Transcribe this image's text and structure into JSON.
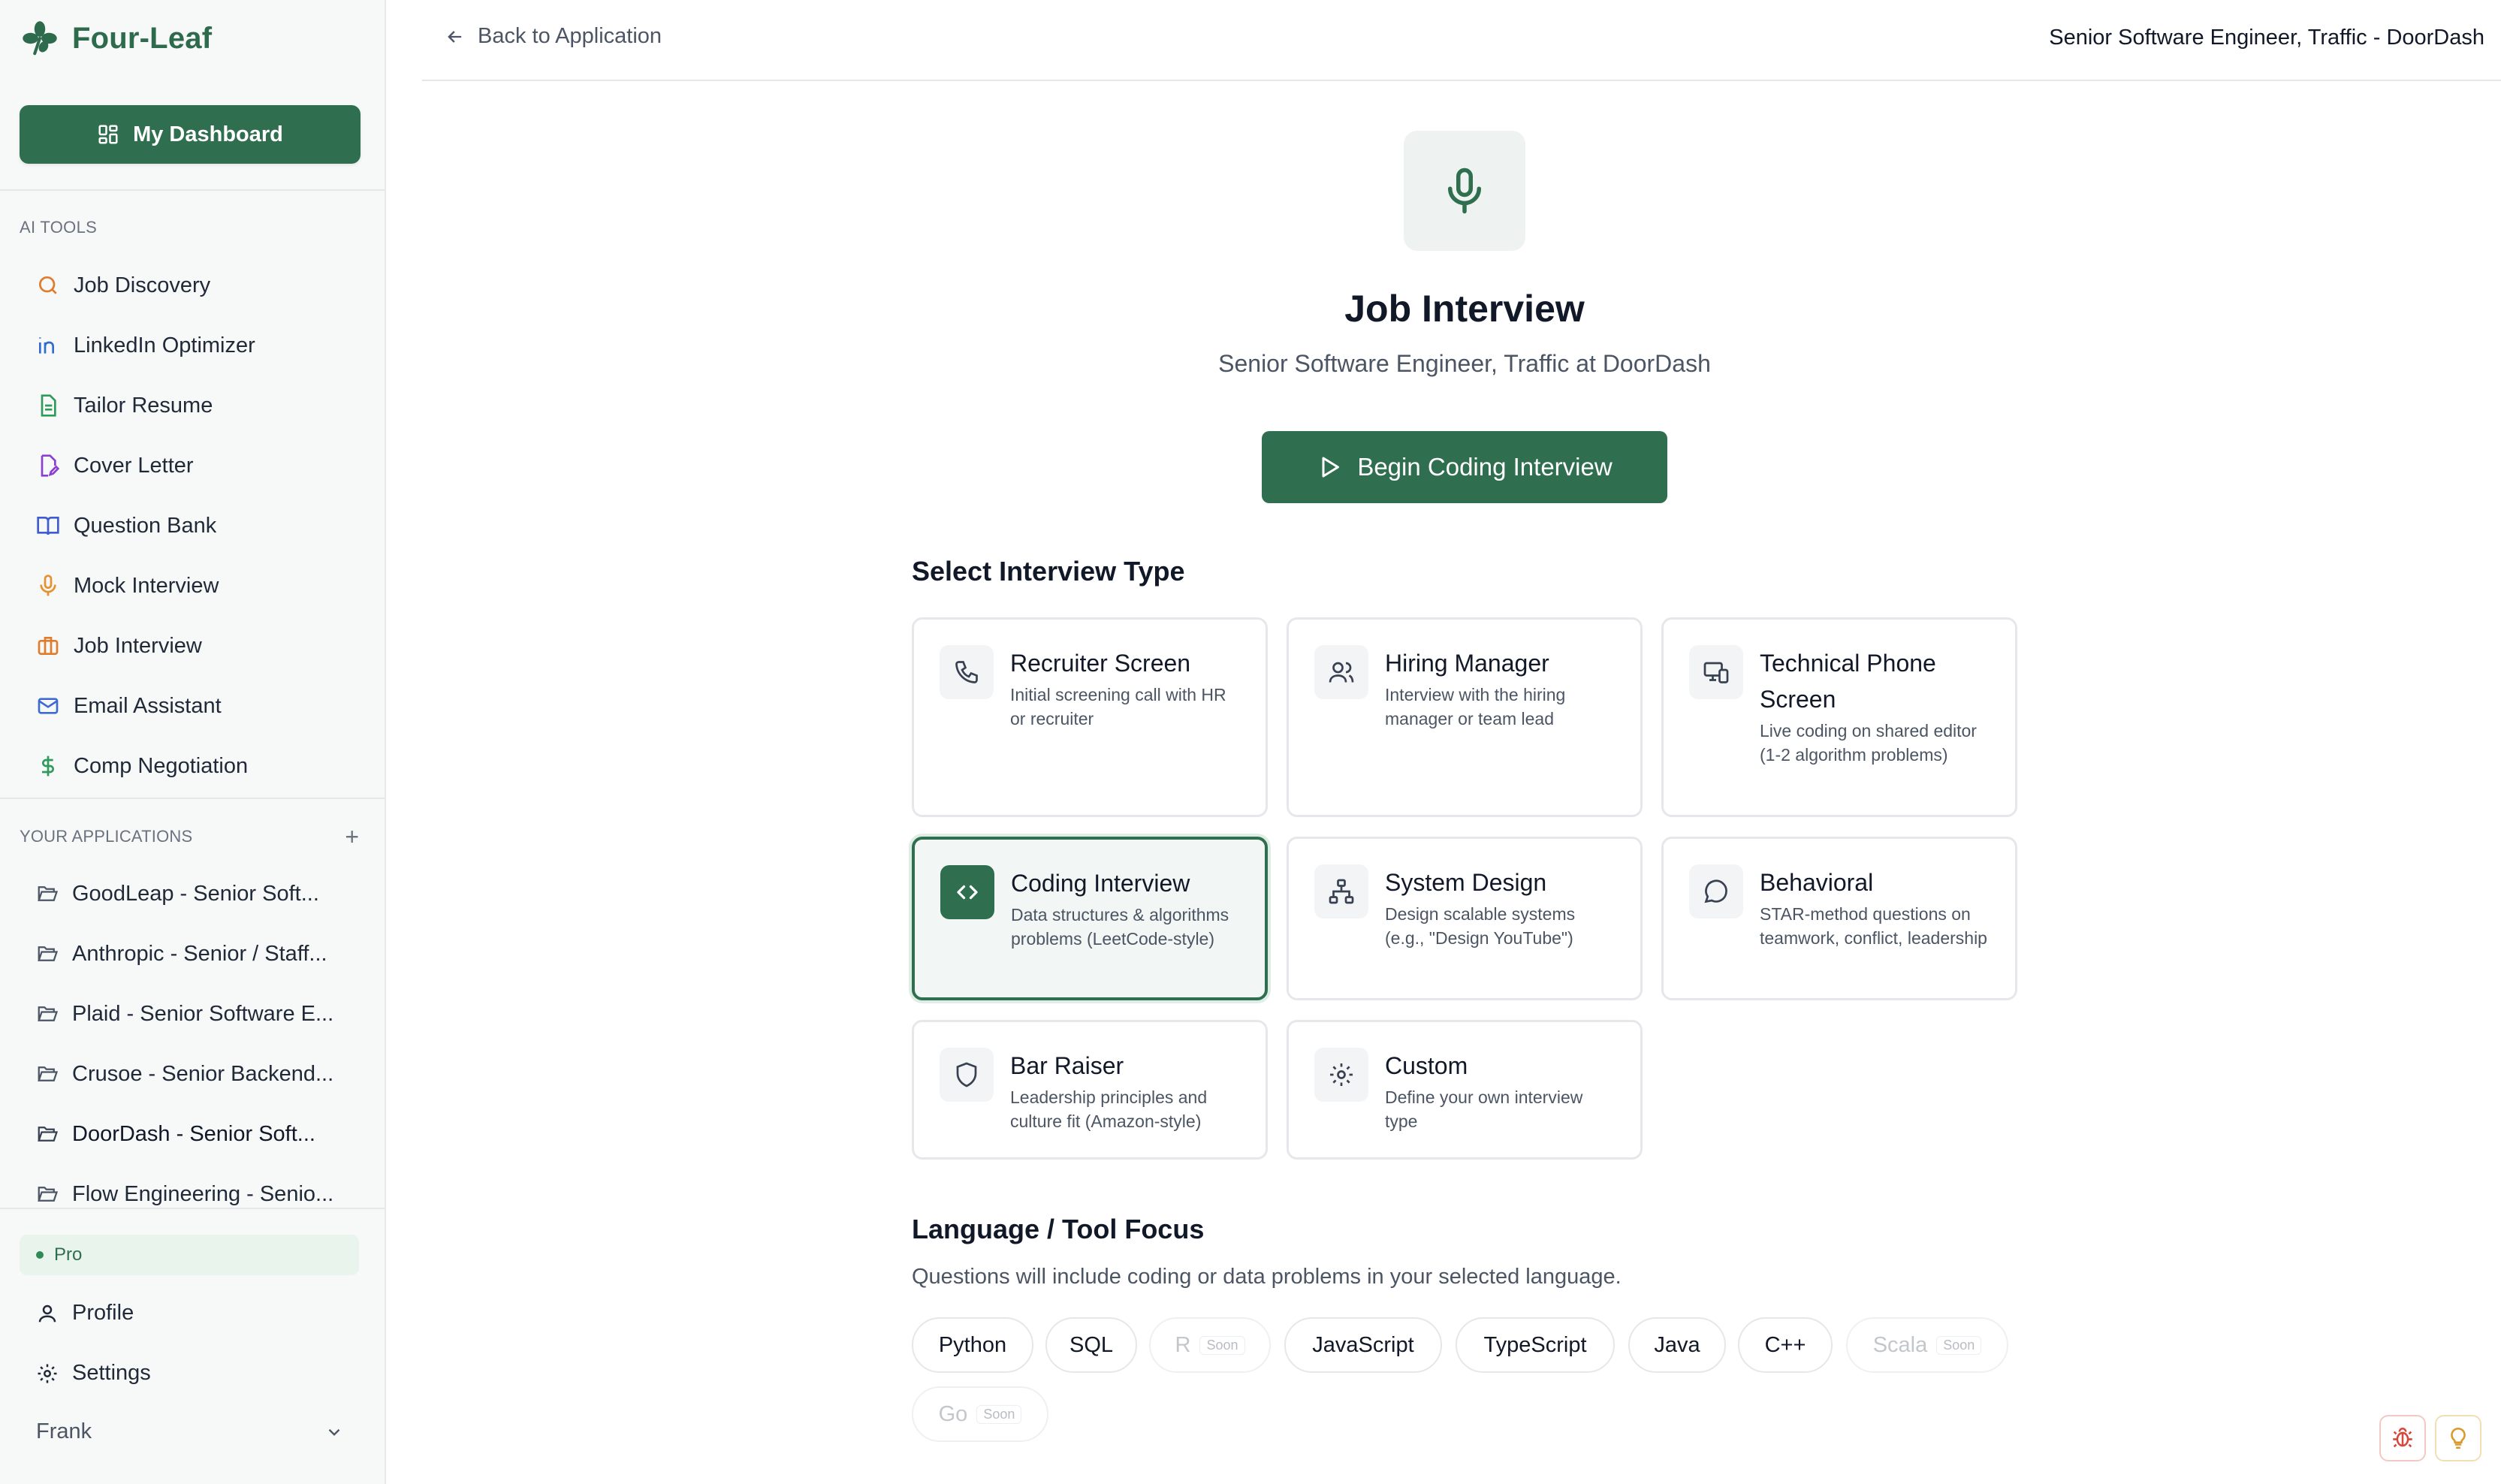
{
  "brand": {
    "name": "Four-Leaf"
  },
  "sidebar": {
    "dashboard_label": "My Dashboard",
    "ai_tools_label": "AI TOOLS",
    "tools": [
      {
        "label": "Job Discovery",
        "icon": "search-icon",
        "color": "#e07a2c"
      },
      {
        "label": "LinkedIn Optimizer",
        "icon": "linkedin-icon",
        "color": "#2f6bd1"
      },
      {
        "label": "Tailor Resume",
        "icon": "file-icon",
        "color": "#2f9a5a"
      },
      {
        "label": "Cover Letter",
        "icon": "file-pen-icon",
        "color": "#8b3fd1"
      },
      {
        "label": "Question Bank",
        "icon": "book-icon",
        "color": "#3f5bd1"
      },
      {
        "label": "Mock Interview",
        "icon": "mic-icon",
        "color": "#e8902c"
      },
      {
        "label": "Job Interview",
        "icon": "briefcase-icon",
        "color": "#e07a2c"
      },
      {
        "label": "Email Assistant",
        "icon": "mail-icon",
        "color": "#3f6bd1"
      },
      {
        "label": "Comp Negotiation",
        "icon": "dollar-icon",
        "color": "#2f9a5a"
      }
    ],
    "applications_label": "YOUR APPLICATIONS",
    "applications": [
      {
        "label": "GoodLeap - Senior Soft..."
      },
      {
        "label": "Anthropic - Senior / Staff..."
      },
      {
        "label": "Plaid - Senior Software E..."
      },
      {
        "label": "Crusoe - Senior Backend..."
      },
      {
        "label": "DoorDash - Senior Soft..."
      },
      {
        "label": "Flow Engineering - Senio..."
      }
    ],
    "plan_label": "Pro",
    "profile_label": "Profile",
    "settings_label": "Settings",
    "user_name": "Frank"
  },
  "topbar": {
    "back_label": "Back to Application",
    "job_title": "Senior Software Engineer, Traffic - DoorDash"
  },
  "main": {
    "title": "Job Interview",
    "subtitle": "Senior Software Engineer, Traffic at DoorDash",
    "begin_label": "Begin Coding Interview",
    "select_type_title": "Select Interview Type",
    "interview_types": [
      {
        "title": "Recruiter Screen",
        "desc": "Initial screening call with HR or recruiter",
        "icon": "phone-icon"
      },
      {
        "title": "Hiring Manager",
        "desc": "Interview with the hiring manager or team lead",
        "icon": "users-icon"
      },
      {
        "title": "Technical Phone Screen",
        "desc": "Live coding on shared editor (1-2 algorithm problems)",
        "icon": "monitor-phone-icon"
      },
      {
        "title": "Coding Interview",
        "desc": "Data structures & algorithms problems (LeetCode-style)",
        "icon": "code-icon",
        "selected": true
      },
      {
        "title": "System Design",
        "desc": "Design scalable systems (e.g., \"Design YouTube\")",
        "icon": "network-icon"
      },
      {
        "title": "Behavioral",
        "desc": "STAR-method questions on teamwork, conflict, leadership",
        "icon": "chat-icon"
      },
      {
        "title": "Bar Raiser",
        "desc": "Leadership principles and culture fit (Amazon-style)",
        "icon": "shield-icon"
      },
      {
        "title": "Custom",
        "desc": "Define your own interview type",
        "icon": "gear-icon"
      }
    ],
    "language_title": "Language / Tool Focus",
    "language_subtitle": "Questions will include coding or data problems in your selected language.",
    "soon_label": "Soon",
    "languages": [
      {
        "label": "Python"
      },
      {
        "label": "SQL"
      },
      {
        "label": "R",
        "soon": true
      },
      {
        "label": "JavaScript"
      },
      {
        "label": "TypeScript"
      },
      {
        "label": "Java"
      },
      {
        "label": "C++"
      },
      {
        "label": "Scala",
        "soon": true
      },
      {
        "label": "Go",
        "soon": true
      }
    ]
  },
  "colors": {
    "accent": "#2f6f4f",
    "bug_button": "#d9463b",
    "idea_button": "#d99a2b"
  }
}
